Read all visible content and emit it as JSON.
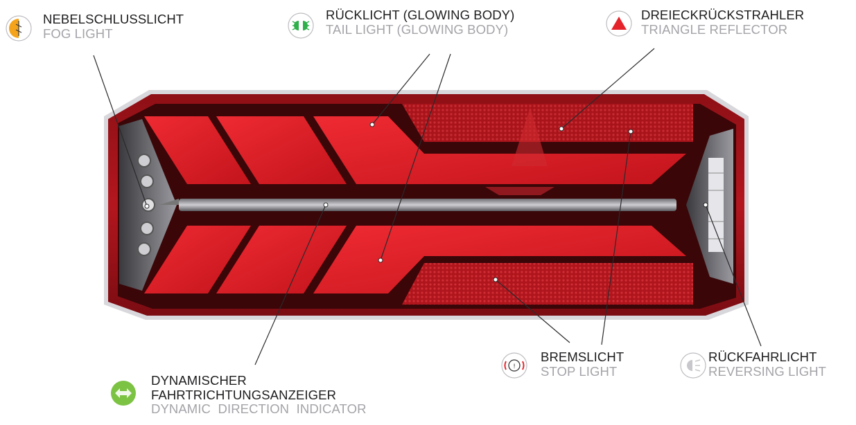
{
  "labels": {
    "fog": {
      "title": "NEBELSCHLUSSLICHT",
      "sub": "FOG LIGHT",
      "icon": "fog-light-icon",
      "color": "#f5a31a"
    },
    "tail": {
      "title": "RÜCKLICHT (GLOWING BODY)",
      "sub": "TAIL LIGHT (GLOWING BODY)",
      "icon": "tail-light-icon",
      "color": "#2fb04a"
    },
    "triangle": {
      "title": "DREIECKRÜCKSTRAHLER",
      "sub": "TRIANGLE REFLECTOR",
      "icon": "triangle-reflector-icon",
      "color": "#e5232b"
    },
    "stop": {
      "title": "BREMSLICHT",
      "sub": "STOP LIGHT",
      "icon": "stop-light-icon",
      "color": "#e5232b"
    },
    "reverse": {
      "title": "RÜCKFAHRLICHT",
      "sub": "REVERSING LIGHT",
      "icon": "reversing-light-icon",
      "color": "#c8c8cc"
    },
    "indicator": {
      "title1": "DYNAMISCHER",
      "title2": "FAHRTRICHTUNGSANZEIGER",
      "sub": "DYNAMIC  DIRECTION  INDICATOR",
      "icon": "dynamic-indicator-icon",
      "color": "#7cc243"
    }
  }
}
